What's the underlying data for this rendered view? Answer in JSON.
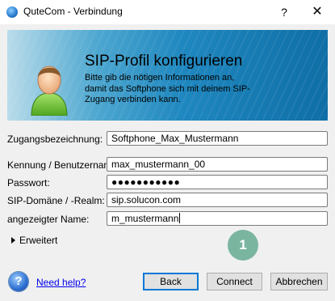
{
  "window": {
    "title": "QuteCom - Verbindung",
    "help_label": "?",
    "close_label": "✕"
  },
  "header": {
    "title": "SIP-Profil konfigurieren",
    "description": "Bitte gib die nötigen Informationen an, damit das Softphone sich mit deinem SIP-Zugang verbinden kann."
  },
  "form": {
    "fields": [
      {
        "label": "Zugangsbezeichnung:",
        "value": "Softphone_Max_Mustermann"
      },
      {
        "label": "Kennung / Benutzername:",
        "value": "max_mustermann_00"
      },
      {
        "label": "Passwort:",
        "value": "●●●●●●●●●●●"
      },
      {
        "label": "SIP-Domäne / -Realm:",
        "value": "sip.solucon.com"
      },
      {
        "label": "angezeigter Name:",
        "value": "m_mustermann"
      }
    ]
  },
  "advanced": {
    "label": "Erweitert"
  },
  "step_badge": "1",
  "footer": {
    "help_icon": "?",
    "help_link": "Need help?",
    "back": "Back",
    "connect": "Connect",
    "cancel": "Abbrechen"
  }
}
